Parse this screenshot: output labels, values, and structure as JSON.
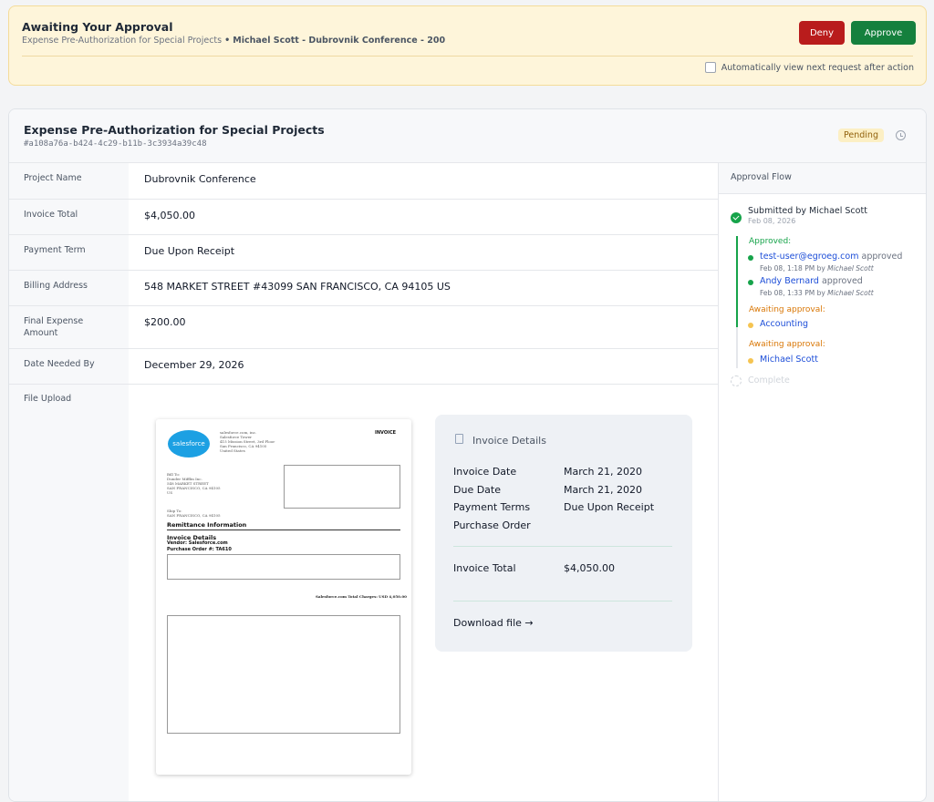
{
  "banner": {
    "title": "Awaiting Your Approval",
    "subtitle_prefix": "Expense Pre-Authorization for Special Projects",
    "subtitle_bullet": "•",
    "subtitle_bold": "Michael Scott - Dubrovnik Conference - 200",
    "deny_label": "Deny",
    "approve_label": "Approve",
    "auto_label": "Automatically view next request after action",
    "colors": {
      "deny": "#b91c1c",
      "approve": "#15803d",
      "banner_bg": "#fef5da"
    }
  },
  "card": {
    "title": "Expense Pre-Authorization for Special Projects",
    "id": "#a108a76a-b424-4c29-b11b-3c3934a39c48",
    "status": "Pending",
    "status_icon": "clock-icon"
  },
  "fields": [
    {
      "label": "Project Name",
      "value": "Dubrovnik Conference"
    },
    {
      "label": "Invoice Total",
      "value": "$4,050.00"
    },
    {
      "label": "Payment Term",
      "value": "Due Upon Receipt"
    },
    {
      "label": "Billing Address",
      "value": "548 MARKET STREET #43099 SAN FRANCISCO, CA 94105 US"
    },
    {
      "label": "Final Expense Amount",
      "value": "$200.00"
    },
    {
      "label": "Date Needed By",
      "value": "December 29, 2026"
    },
    {
      "label": "File Upload",
      "value": ""
    }
  ],
  "document": {
    "logo": "salesforce",
    "invoice_word": "INVOICE",
    "remittance": "Remittance Information",
    "details": "Invoice Details",
    "vendor": "Vendor: Salesforce.com",
    "po": "Purchase Order #: TA610",
    "total_line": "Salesforce.com Total Charges: USD 4,050.00"
  },
  "invoice_details": {
    "title": "Invoice Details",
    "rows": [
      {
        "key": "Invoice Date",
        "value": "March 21, 2020"
      },
      {
        "key": "Due Date",
        "value": "March 21, 2020"
      },
      {
        "key": "Payment Terms",
        "value": "Due Upon Receipt"
      },
      {
        "key": "Purchase Order",
        "value": ""
      }
    ],
    "total_key": "Invoice Total",
    "total_value": "$4,050.00",
    "download": "Download file →"
  },
  "approval_flow": {
    "title": "Approval Flow",
    "submitted": "Submitted by Michael Scott",
    "submitted_date": "Feb 08, 2026",
    "approved_label": "Approved:",
    "approvers": [
      {
        "name": "test-user@egroeg.com",
        "action": "approved",
        "meta": "Feb 08, 1:18 PM by",
        "by": "Michael Scott"
      },
      {
        "name": "Andy Bernard",
        "action": "approved",
        "meta": "Feb 08, 1:33 PM by",
        "by": "Michael Scott"
      }
    ],
    "awaiting1_label": "Awaiting approval:",
    "awaiting1_name": "Accounting",
    "awaiting2_label": "Awaiting approval:",
    "awaiting2_name": "Michael Scott",
    "complete": "Complete"
  }
}
